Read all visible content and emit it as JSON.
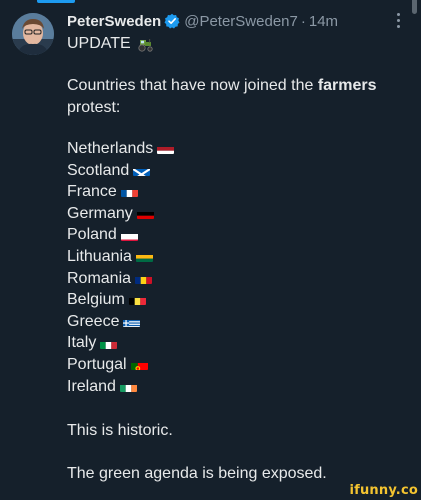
{
  "tweet": {
    "author_name": "PeterSweden",
    "handle": "@PeterSweden7",
    "separator": "·",
    "time": "14m",
    "update_label": "UPDATE",
    "intro_prefix": "Countries that have now joined the ",
    "intro_bold": "farmers",
    "intro_suffix": "protest:",
    "countries": [
      {
        "name": "Netherlands",
        "flag": "netherlands-flag-icon"
      },
      {
        "name": "Scotland",
        "flag": "scotland-flag-icon"
      },
      {
        "name": "France",
        "flag": "france-flag-icon"
      },
      {
        "name": "Germany",
        "flag": "germany-flag-icon"
      },
      {
        "name": "Poland",
        "flag": "poland-flag-icon"
      },
      {
        "name": "Lithuania",
        "flag": "lithuania-flag-icon"
      },
      {
        "name": "Romania",
        "flag": "romania-flag-icon"
      },
      {
        "name": "Belgium",
        "flag": "belgium-flag-icon"
      },
      {
        "name": "Greece",
        "flag": "greece-flag-icon"
      },
      {
        "name": "Italy",
        "flag": "italy-flag-icon"
      },
      {
        "name": "Portugal",
        "flag": "portugal-flag-icon"
      },
      {
        "name": "Ireland",
        "flag": "ireland-flag-icon"
      }
    ],
    "closing_1": "This is historic.",
    "closing_2": "The green agenda is being exposed."
  },
  "watermark": "ifunny.co",
  "colors": {
    "background": "#15202b",
    "text": "#e7e9ea",
    "muted": "#8b98a5",
    "accent": "#1d9bf0",
    "watermark": "#f4c430"
  }
}
